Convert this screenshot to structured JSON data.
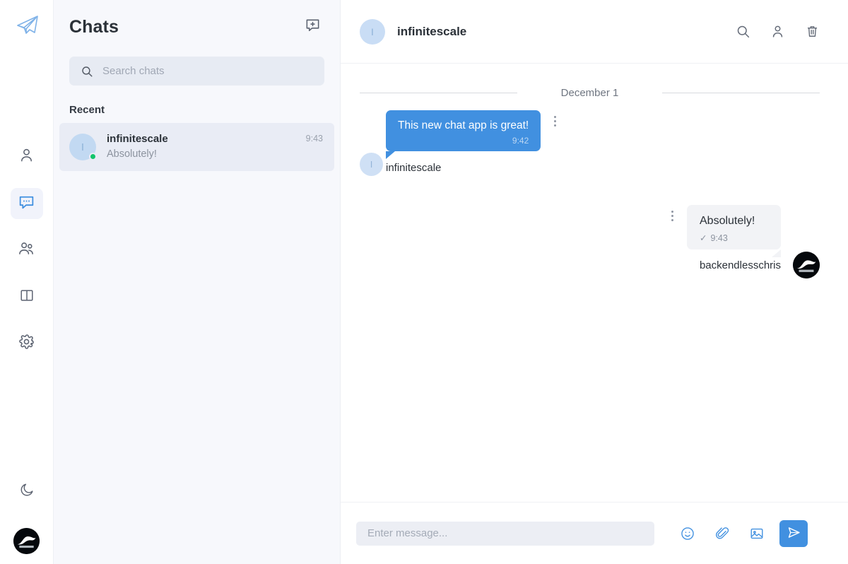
{
  "rail": {
    "logo": "paper-plane-logo",
    "items": [
      {
        "name": "contacts",
        "icon": "person-icon",
        "active": false
      },
      {
        "name": "chats",
        "icon": "chat-bubble-icon",
        "active": true
      },
      {
        "name": "groups",
        "icon": "people-group-icon",
        "active": false
      },
      {
        "name": "panels",
        "icon": "sidebar-panel-icon",
        "active": false
      },
      {
        "name": "settings",
        "icon": "gear-icon",
        "active": false
      }
    ],
    "theme_toggle": {
      "name": "dark-mode",
      "icon": "moon-icon"
    },
    "user_avatar": "backendless-logo-avatar"
  },
  "sidebar": {
    "title": "Chats",
    "new_chat_icon": "new-chat-icon",
    "search": {
      "placeholder": "Search chats",
      "value": "",
      "icon": "search-icon"
    },
    "section_label": "Recent",
    "chats": [
      {
        "avatar_initial": "I",
        "name": "infinitescale",
        "preview": "Absolutely!",
        "time": "9:43",
        "online": true,
        "selected": true
      }
    ]
  },
  "header": {
    "avatar_initial": "I",
    "title": "infinitescale",
    "actions": [
      {
        "name": "search-conversation",
        "icon": "search-icon"
      },
      {
        "name": "contact-info",
        "icon": "person-icon"
      },
      {
        "name": "delete-conversation",
        "icon": "trash-icon"
      }
    ]
  },
  "thread": {
    "date_divider": "December 1",
    "messages": [
      {
        "direction": "incoming",
        "avatar_initial": "I",
        "sender": "infinitescale",
        "text": "This new chat app is great!",
        "time": "9:42",
        "status": "",
        "menu_icon": "more-vertical-icon"
      },
      {
        "direction": "outgoing",
        "avatar": "backendless-logo-avatar",
        "sender": "backendlesschris",
        "text": "Absolutely!",
        "time": "9:43",
        "status": "✓",
        "menu_icon": "more-vertical-icon"
      }
    ]
  },
  "composer": {
    "placeholder": "Enter message...",
    "value": "",
    "actions": [
      {
        "name": "emoji",
        "icon": "emoji-icon"
      },
      {
        "name": "attach-file",
        "icon": "paperclip-icon"
      },
      {
        "name": "attach-image",
        "icon": "image-icon"
      }
    ],
    "send": {
      "name": "send-message",
      "icon": "send-icon"
    }
  },
  "colors": {
    "accent": "#4190e0",
    "bubble_incoming": "#4190e0",
    "bubble_outgoing": "#f2f3f6",
    "sidebar_bg": "#f7f8fc",
    "online": "#13c56b"
  }
}
